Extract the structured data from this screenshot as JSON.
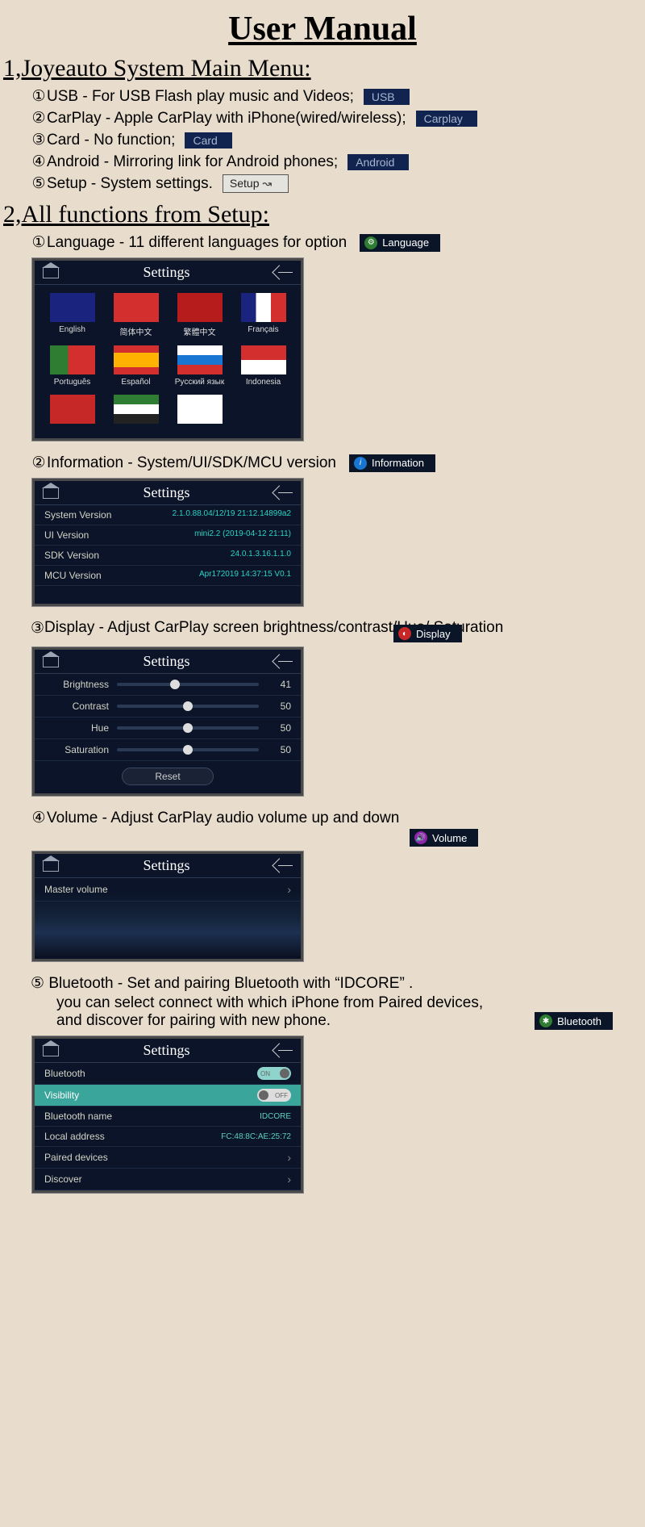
{
  "title": "User Manual",
  "section1": {
    "heading": "1,Joyeauto System Main Menu:",
    "items": [
      {
        "num": "①",
        "text": "USB - For USB Flash play music and Videos;",
        "tag": "USB",
        "tagClass": ""
      },
      {
        "num": "②",
        "text": "CarPlay - Apple CarPlay with iPhone(wired/wireless);",
        "tag": "Carplay",
        "tagClass": ""
      },
      {
        "num": "③",
        "text": "Card - No function;",
        "tag": "Card",
        "tagClass": ""
      },
      {
        "num": "④",
        "text": "Android - Mirroring link for Android phones;",
        "tag": "Android",
        "tagClass": ""
      },
      {
        "num": "⑤",
        "text": "Setup - System settings.",
        "tag": "Setup",
        "tagClass": "setup"
      }
    ]
  },
  "section2": {
    "heading": "2,All functions from Setup:",
    "lang": {
      "num": "①",
      "text": "Language - 11 different languages for option",
      "btn": "Language",
      "settings_title": "Settings",
      "flags": [
        {
          "cls": "uk",
          "label": "English"
        },
        {
          "cls": "cn",
          "label": "简体中文"
        },
        {
          "cls": "hk",
          "label": "繁體中文"
        },
        {
          "cls": "fr",
          "label": "Français"
        },
        {
          "cls": "pt",
          "label": "Português"
        },
        {
          "cls": "es",
          "label": "Español"
        },
        {
          "cls": "ru",
          "label": "Русский язык"
        },
        {
          "cls": "id",
          "label": "Indonesia"
        },
        {
          "cls": "tr",
          "label": ""
        },
        {
          "cls": "ae",
          "label": ""
        },
        {
          "cls": "kr",
          "label": ""
        }
      ]
    },
    "info": {
      "num": "②",
      "text": " Information - System/UI/SDK/MCU version",
      "btn": "Information",
      "settings_title": "Settings",
      "rows": [
        {
          "k": "System Version",
          "v": "2.1.0.88.04/12/19 21:12.14899a2"
        },
        {
          "k": "UI Version",
          "v": "mini2.2 (2019-04-12 21:11)"
        },
        {
          "k": "SDK Version",
          "v": "24.0.1.3.16.1.1.0"
        },
        {
          "k": "MCU Version",
          "v": "Apr172019 14:37:15 V0.1"
        }
      ]
    },
    "display": {
      "num": "③",
      "text": "Display - Adjust CarPlay screen brightness/contrast/Hue/ Saturation",
      "btn": "Display",
      "settings_title": "Settings",
      "sliders": [
        {
          "lbl": "Brightness",
          "val": 41
        },
        {
          "lbl": "Contrast",
          "val": 50
        },
        {
          "lbl": "Hue",
          "val": 50
        },
        {
          "lbl": "Saturation",
          "val": 50
        }
      ],
      "reset": "Reset"
    },
    "volume": {
      "num": "④",
      "text": "Volume - Adjust CarPlay audio volume up and down",
      "btn": "Volume",
      "settings_title": "Settings",
      "row": "Master volume"
    },
    "bluetooth": {
      "num": "⑤",
      "line1": "Bluetooth - Set and pairing Bluetooth with  “IDCORE” .",
      "line2": "you can select connect with which iPhone from Paired devices,",
      "line3": "and discover for pairing with new phone.",
      "btn": "Bluetooth",
      "settings_title": "Settings",
      "rows": [
        {
          "k": "Bluetooth",
          "type": "toggle",
          "on": true,
          "t_on": "ON"
        },
        {
          "k": "Visibility",
          "type": "toggle",
          "on": false,
          "t_off": "OFF",
          "hl": true
        },
        {
          "k": "Bluetooth name",
          "type": "val",
          "v": "IDCORE"
        },
        {
          "k": "Local address",
          "type": "val",
          "v": "FC:48:8C:AE:25:72"
        },
        {
          "k": "Paired devices",
          "type": "chev"
        },
        {
          "k": "Discover",
          "type": "chev"
        }
      ]
    }
  }
}
